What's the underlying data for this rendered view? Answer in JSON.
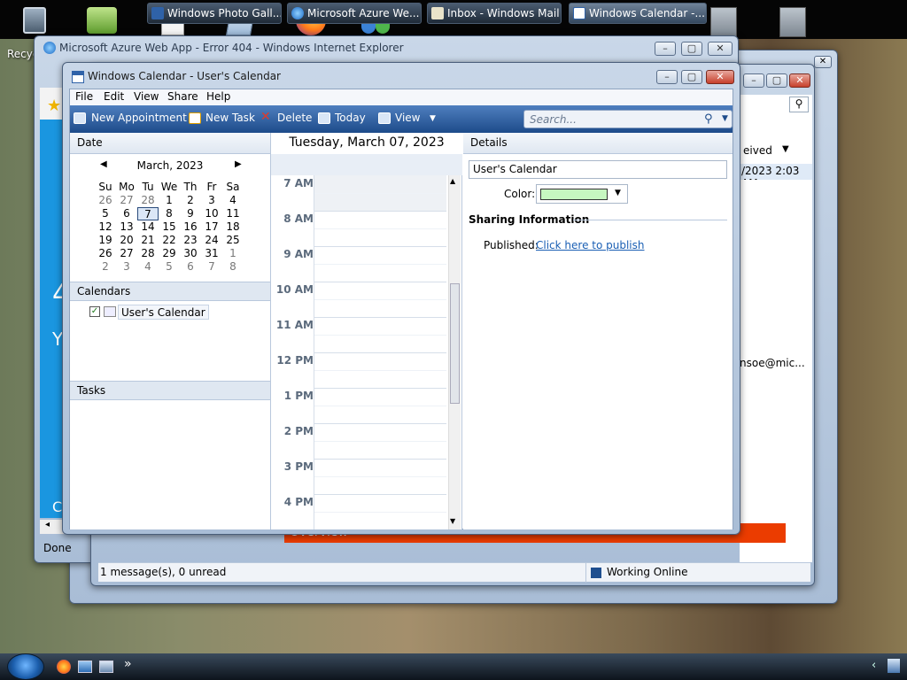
{
  "desktop": {
    "recycle_label": "Recyc"
  },
  "photo_gallery": {
    "visible_text": ""
  },
  "ie": {
    "title": "Microsoft Azure Web App - Error 404 - Windows Internet Explorer",
    "status": "Done",
    "partial_text": "Y",
    "partial_big": "4",
    "partial_c": "C"
  },
  "mail": {
    "col_received": "eived",
    "received_value": "/2023 2:03 AM",
    "from_fragment": "nsoe@mic...",
    "banner_text": "Overview",
    "status_messages": "1 message(s), 0 unread",
    "status_online": "Working Online"
  },
  "calendar": {
    "title": "Windows Calendar - User's Calendar",
    "menu": [
      "File",
      "Edit",
      "View",
      "Share",
      "Help"
    ],
    "toolbar": {
      "new_appointment": "New Appointment",
      "new_task": "New Task",
      "delete": "Delete",
      "today": "Today",
      "view": "View"
    },
    "search_placeholder": "Search...",
    "date_header": "Date",
    "month_label": "March, 2023",
    "weekdays": [
      "Su",
      "Mo",
      "Tu",
      "We",
      "Th",
      "Fr",
      "Sa"
    ],
    "weeks": [
      [
        "26",
        "27",
        "28",
        "1",
        "2",
        "3",
        "4"
      ],
      [
        "5",
        "6",
        "7",
        "8",
        "9",
        "10",
        "11"
      ],
      [
        "12",
        "13",
        "14",
        "15",
        "16",
        "17",
        "18"
      ],
      [
        "19",
        "20",
        "21",
        "22",
        "23",
        "24",
        "25"
      ],
      [
        "26",
        "27",
        "28",
        "29",
        "30",
        "31",
        "1"
      ],
      [
        "2",
        "3",
        "4",
        "5",
        "6",
        "7",
        "8"
      ]
    ],
    "calendars_header": "Calendars",
    "calendar_item": "User's Calendar",
    "tasks_header": "Tasks",
    "day_title": "Tuesday, March 07, 2023",
    "hours": [
      "7 AM",
      "8 AM",
      "9 AM",
      "10 AM",
      "11 AM",
      "12 PM",
      "1 PM",
      "2 PM",
      "3 PM",
      "4 PM"
    ],
    "details_header": "Details",
    "details_name": "User's Calendar",
    "color_label": "Color:",
    "color_value": "#c6f7c0",
    "sharing_header": "Sharing Information",
    "published_label": "Published:",
    "publish_link": "Click here to publish"
  },
  "taskbar": {
    "tasks": [
      "Windows Photo Gall...",
      "Microsoft Azure We...",
      "Inbox - Windows Mail",
      "Windows Calendar -..."
    ],
    "chevron": "»"
  }
}
